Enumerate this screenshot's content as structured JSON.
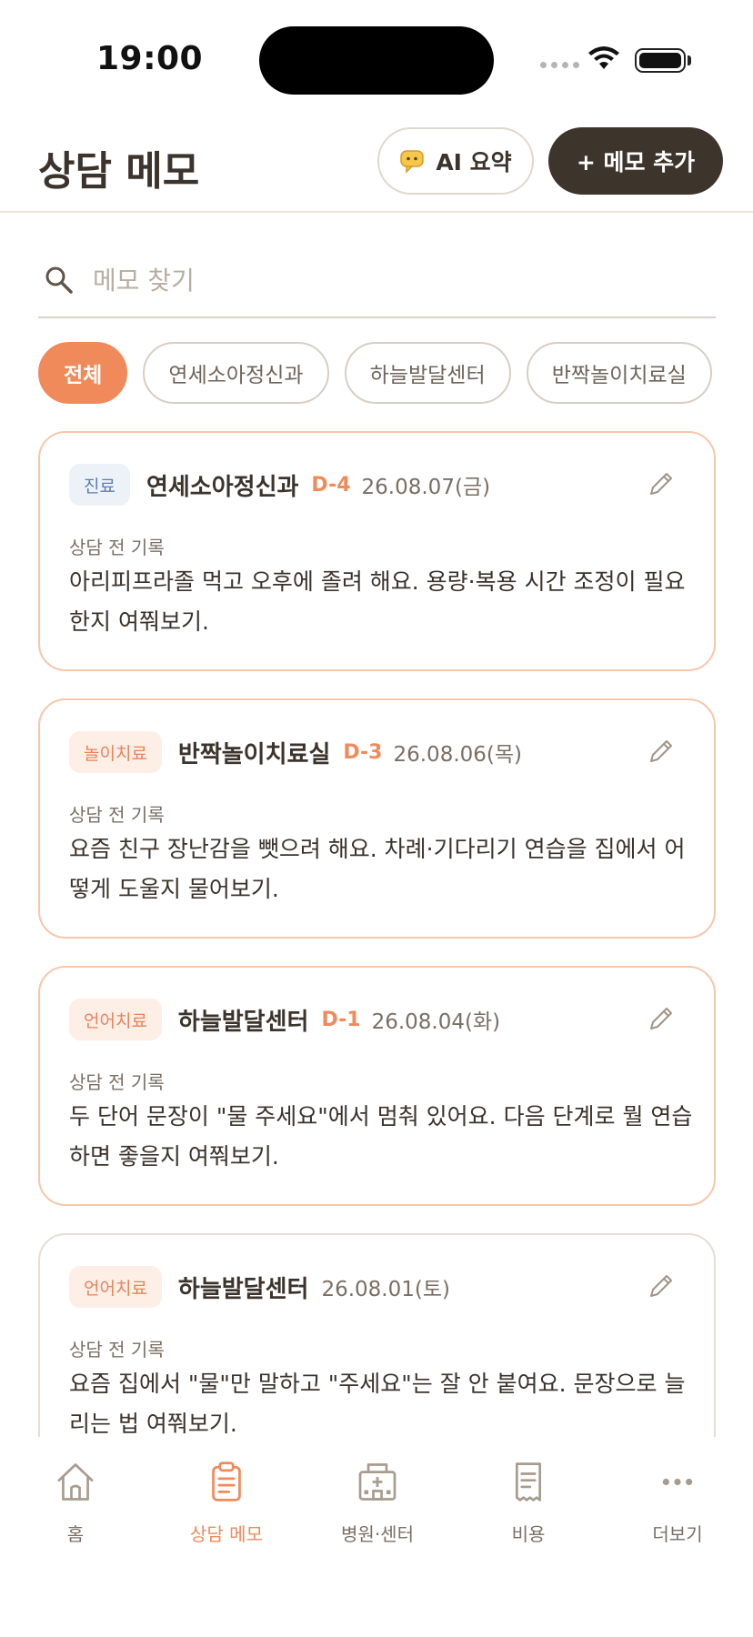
{
  "status_bar": {
    "time": "19:00"
  },
  "header": {
    "title": "상담 메모",
    "ai_button": "AI 요약",
    "add_button": "+ 메모 추가"
  },
  "search": {
    "placeholder": "메모 찾기",
    "value": ""
  },
  "filters": [
    {
      "label": "전체",
      "active": true
    },
    {
      "label": "연세소아정신과",
      "active": false
    },
    {
      "label": "하늘발달센터",
      "active": false
    },
    {
      "label": "반짝놀이치료실",
      "active": false
    }
  ],
  "memos": [
    {
      "tag": "진료",
      "tag_color": "blue",
      "place": "연세소아정신과",
      "dday": "D-4",
      "date": "26.08.07(금)",
      "label": "상담 전 기록",
      "text": "아리피프라졸 먹고 오후에 졸려 해요. 용량·복용 시간 조정이 필요한지 여쭤보기."
    },
    {
      "tag": "놀이치료",
      "tag_color": "peach",
      "place": "반짝놀이치료실",
      "dday": "D-3",
      "date": "26.08.06(목)",
      "label": "상담 전 기록",
      "text": "요즘 친구 장난감을 뺏으려 해요. 차례·기다리기 연습을 집에서 어떻게 도울지 물어보기."
    },
    {
      "tag": "언어치료",
      "tag_color": "peach",
      "place": "하늘발달센터",
      "dday": "D-1",
      "date": "26.08.04(화)",
      "label": "상담 전 기록",
      "text": "두 단어 문장이 \"물 주세요\"에서 멈춰 있어요. 다음 단계로 뭘 연습하면 좋을지 여쭤보기."
    },
    {
      "tag": "언어치료",
      "tag_color": "peach",
      "place": "하늘발달센터",
      "dday": "",
      "date": "26.08.01(토)",
      "label": "상담 전 기록",
      "text": "요즘 집에서 \"물\"만 말하고 \"주세요\"는 잘 안 붙여요. 문장으로 늘리는 법 여쭤보기."
    }
  ],
  "tabs": [
    {
      "label": "홈",
      "icon": "home-icon",
      "active": false
    },
    {
      "label": "상담 메모",
      "icon": "clipboard-icon",
      "active": true
    },
    {
      "label": "병원·센터",
      "icon": "hospital-icon",
      "active": false
    },
    {
      "label": "비용",
      "icon": "receipt-icon",
      "active": false
    },
    {
      "label": "더보기",
      "icon": "more-icon",
      "active": false
    }
  ],
  "colors": {
    "accent": "#f08a5b",
    "dark": "#3d342c",
    "card_border": "#f7c7aa"
  }
}
